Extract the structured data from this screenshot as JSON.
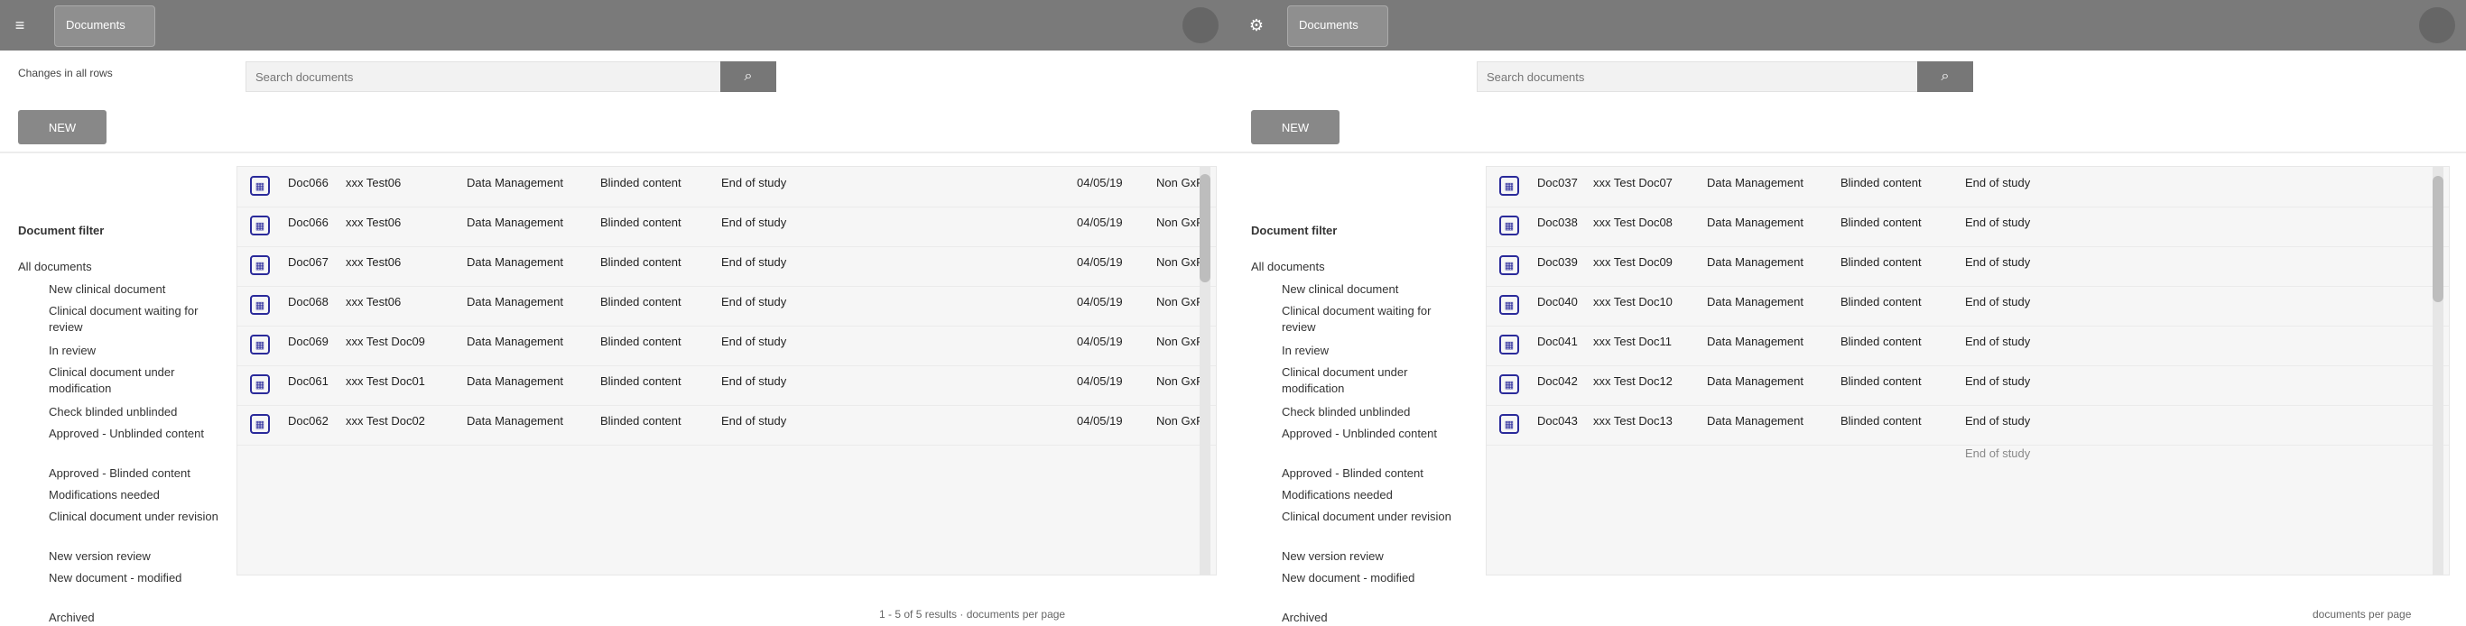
{
  "topbar": {
    "left_tabs": [
      {
        "label": "Documents"
      }
    ],
    "right_tabs": [
      {
        "label": "Documents"
      }
    ]
  },
  "left_panel": {
    "filter_label": "Changes in all rows",
    "search_placeholder": "Search documents",
    "new_label": "NEW",
    "sidebar_title": "Document filter",
    "sidebar_subtitle": "All documents",
    "sidebar_items": [
      "New clinical document",
      "Clinical document waiting for review",
      "In review",
      "Clinical document under modification",
      "Check blinded unblinded",
      "Approved - Unblinded content",
      "Approved - Blinded content",
      "Modifications needed",
      "Clinical document under revision",
      "New version review",
      "New document - modified",
      "Archived"
    ],
    "table": {
      "rows": [
        {
          "id": "Doc066",
          "name": "xxx Test06",
          "type": "Data Management",
          "content": "Blinded content",
          "stage": "End of study",
          "date": "04/05/19",
          "status": "Non GxP"
        },
        {
          "id": "Doc066",
          "name": "xxx Test06",
          "type": "Data Management",
          "content": "Blinded content",
          "stage": "End of study",
          "date": "04/05/19",
          "status": "Non GxP"
        },
        {
          "id": "Doc067",
          "name": "xxx Test06",
          "type": "Data Management",
          "content": "Blinded content",
          "stage": "End of study",
          "date": "04/05/19",
          "status": "Non GxP"
        },
        {
          "id": "Doc068",
          "name": "xxx Test06",
          "type": "Data Management",
          "content": "Blinded content",
          "stage": "End of study",
          "date": "04/05/19",
          "status": "Non GxP"
        },
        {
          "id": "Doc069",
          "name": "xxx Test Doc09",
          "type": "Data Management",
          "content": "Blinded content",
          "stage": "End of study",
          "date": "04/05/19",
          "status": "Non GxP"
        },
        {
          "id": "Doc061",
          "name": "xxx Test Doc01",
          "type": "Data Management",
          "content": "Blinded content",
          "stage": "End of study",
          "date": "04/05/19",
          "status": "Non GxP"
        },
        {
          "id": "Doc062",
          "name": "xxx Test Doc02",
          "type": "Data Management",
          "content": "Blinded content",
          "stage": "End of study",
          "date": "04/05/19",
          "status": "Non GxP"
        }
      ]
    },
    "footer": "1 - 5 of 5 results  ·  documents per page"
  },
  "right_panel": {
    "search_placeholder": "Search documents",
    "new_label": "NEW",
    "sidebar_title": "Document filter",
    "sidebar_subtitle": "All documents",
    "sidebar_items": [
      "New clinical document",
      "Clinical document waiting for review",
      "In review",
      "Clinical document under modification",
      "Check blinded unblinded",
      "Approved - Unblinded content",
      "Approved - Blinded content",
      "Modifications needed",
      "Clinical document under revision",
      "New version review",
      "New document - modified",
      "Archived"
    ],
    "table": {
      "rows": [
        {
          "id": "Doc037",
          "name": "xxx Test Doc07",
          "type": "Data Management",
          "content": "Blinded content",
          "stage": "End of study"
        },
        {
          "id": "Doc038",
          "name": "xxx Test Doc08",
          "type": "Data Management",
          "content": "Blinded content",
          "stage": "End of study"
        },
        {
          "id": "Doc039",
          "name": "xxx Test Doc09",
          "type": "Data Management",
          "content": "Blinded content",
          "stage": "End of study"
        },
        {
          "id": "Doc040",
          "name": "xxx Test Doc10",
          "type": "Data Management",
          "content": "Blinded content",
          "stage": "End of study"
        },
        {
          "id": "Doc041",
          "name": "xxx Test Doc11",
          "type": "Data Management",
          "content": "Blinded content",
          "stage": "End of study"
        },
        {
          "id": "Doc042",
          "name": "xxx Test Doc12",
          "type": "Data Management",
          "content": "Blinded content",
          "stage": "End of study"
        },
        {
          "id": "Doc043",
          "name": "xxx Test Doc13",
          "type": "Data Management",
          "content": "Blinded content",
          "stage": "End of study"
        }
      ],
      "last_row_stage": "End of study"
    },
    "footer": "documents per page"
  }
}
